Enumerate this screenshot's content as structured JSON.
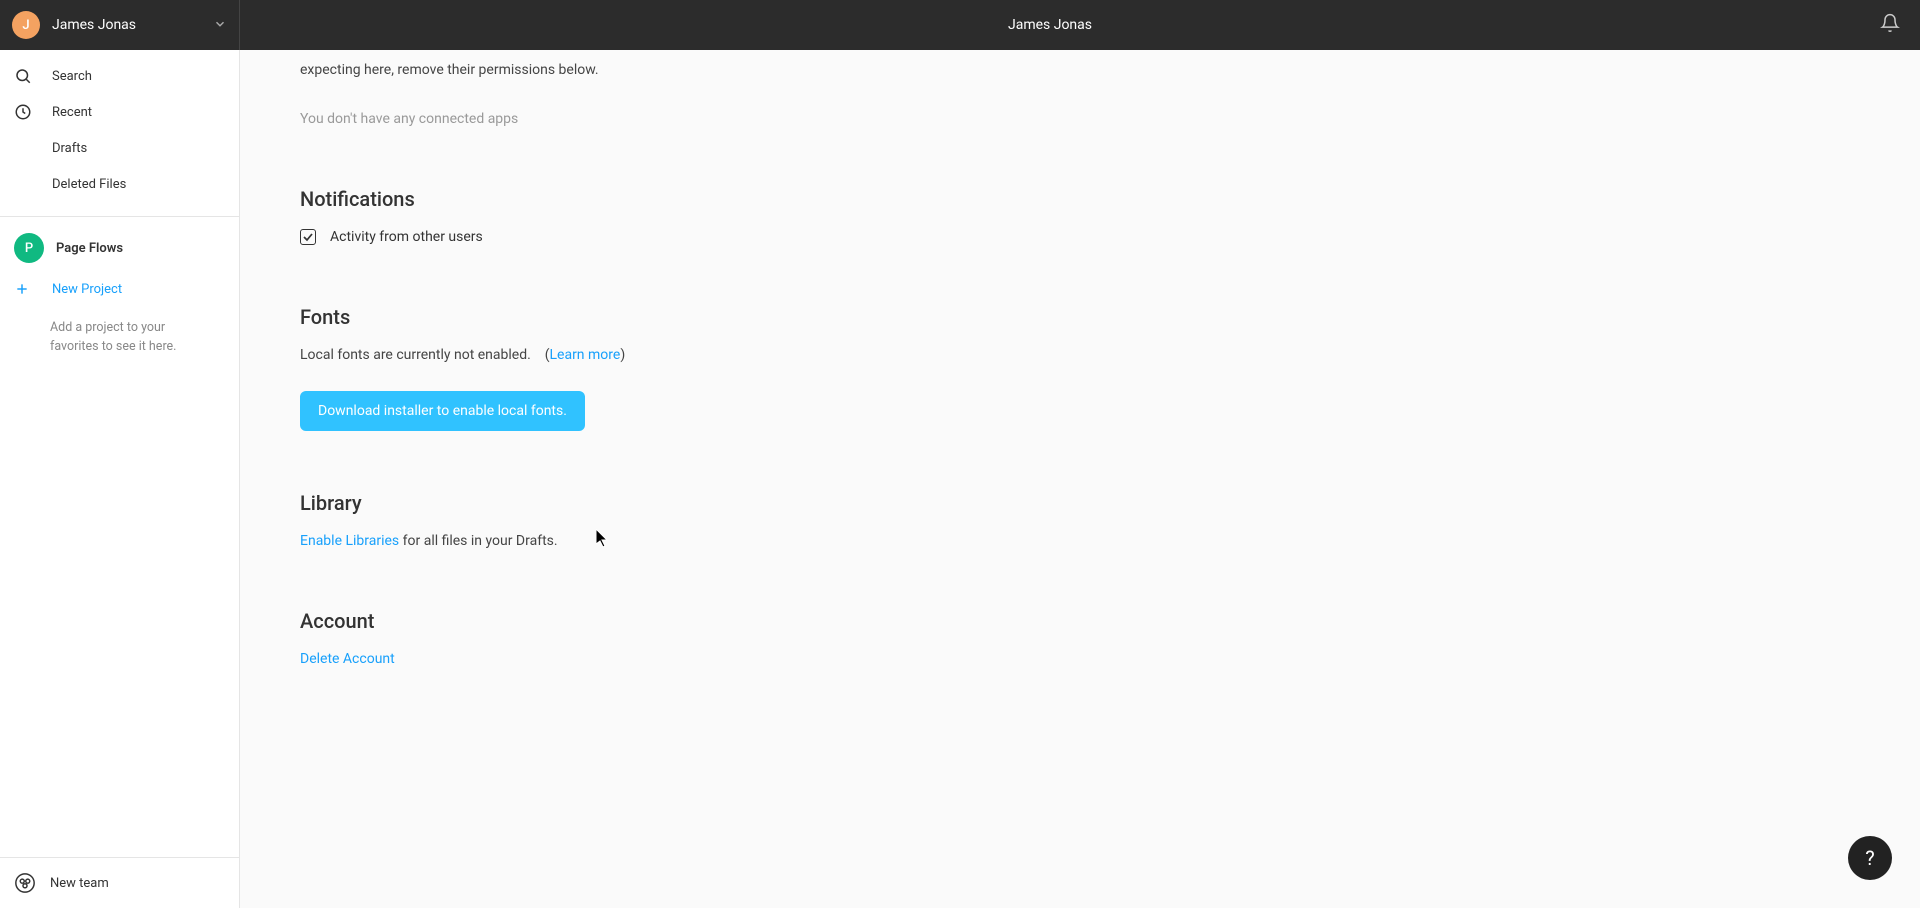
{
  "header": {
    "avatar_initial": "J",
    "username": "James Jonas",
    "page_title": "James Jonas"
  },
  "sidebar": {
    "items": [
      {
        "label": "Search"
      },
      {
        "label": "Recent"
      },
      {
        "label": "Drafts"
      },
      {
        "label": "Deleted Files"
      }
    ],
    "team": {
      "initial": "P",
      "name": "Page Flows"
    },
    "new_project_label": "New Project",
    "favorites_hint": "Add a project to your favorites to see it here.",
    "new_team_label": "New team"
  },
  "main": {
    "connected_apps": {
      "truncated_text": "expecting here, remove their permissions below.",
      "empty_message": "You don't have any connected apps"
    },
    "notifications": {
      "title": "Notifications",
      "checkbox_label": "Activity from other users",
      "checked": true
    },
    "fonts": {
      "title": "Fonts",
      "status_text": "Local fonts are currently not enabled.",
      "learn_more": "Learn more",
      "download_button": "Download installer to enable local fonts."
    },
    "library": {
      "title": "Library",
      "link_text": "Enable Libraries",
      "suffix_text": " for all files in your Drafts."
    },
    "account": {
      "title": "Account",
      "delete_link": "Delete Account"
    }
  },
  "help_fab": "?"
}
